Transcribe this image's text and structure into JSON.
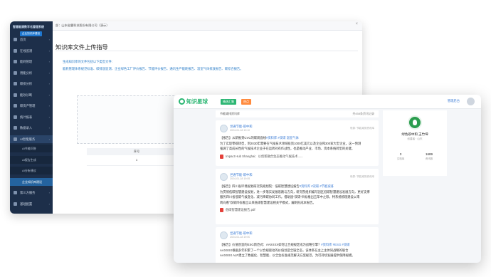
{
  "admin": {
    "brand": "智慧能源数字化管理系统",
    "org": "部：山东省露科技股份有限公司（演示）",
    "tab_label": "企业知识库建设",
    "page_title": "知识库文件上传指导",
    "instructions": "生成知识库的文件包括以下类型文件:",
    "file_types": "能耗管理体系规范标准、碳排放监测、企业绿色工厂评价报告、节能评价报告、通讯生产能耗报告、温室气体排放报告、碳综合报告。",
    "sidebar": [
      {
        "label": "首页"
      },
      {
        "label": "在线监测"
      },
      {
        "label": "能耗管理"
      },
      {
        "label": "用能分析"
      },
      {
        "label": "碳排分析"
      },
      {
        "label": "能效诊断"
      },
      {
        "label": "碳资产管理"
      },
      {
        "label": "统计报表"
      },
      {
        "label": "数据录入"
      },
      {
        "label": "AI智能服务"
      }
    ],
    "sidebar_sub": [
      {
        "label": "AI节能问答"
      },
      {
        "label": "AI报告生成"
      },
      {
        "label": "AI分析建议"
      },
      {
        "label": "企业知识库建设"
      }
    ],
    "sidebar_bottom": [
      {
        "label": "第三方服务"
      },
      {
        "label": "基础配置"
      }
    ],
    "table": {
      "header": "序号",
      "row_value": "1"
    }
  },
  "feed": {
    "logo_text": "知识星球",
    "tab_featured": "精选汇集",
    "tab_hot": "热点",
    "admin_link": "管理后台",
    "filter_label": "节能减排资讯库",
    "result_count": "共458条资讯记录",
    "posts": [
      {
        "author": "世通节能·碳中和",
        "meta": "2024-01-18 19:10",
        "source": "来源: 节能减排资讯库",
        "lines": [
          {
            "text": "【报告】从新推到CVC的碳周面线",
            "tags": "#资料库 #双碳 温室气体"
          },
          {
            "text": "为了实现零碳转型，到2030年需要在气候技术领域投资1000亿美元以及企业和300家大型企业，这一预测",
            "tags": ""
          },
          {
            "text": "强调了高成长性的气候技术企业于在运转对有作战性，也是推动产业、市场、资本系统转型的关键。",
            "tags": ""
          }
        ],
        "attachment": "Impact Hub Shanghai：以创新融合生态推动气候技术......"
      },
      {
        "author": "世通节能·碳中和",
        "meta": "2024-01-18 19:05",
        "source": "来源: 节能减排资讯库",
        "lines": [
          {
            "text": "【报告】四川省环境规划研究院规划院：低碳智慧建设报告",
            "tags": "#资料库 #双碳 #节能减排"
          },
          {
            "text": "为贯彻低碳智慧建设规划，进一步落实发展思路与方向，研究院组织编写园区低碳智慧建设发展方向，更好支撑",
            "tags": ""
          },
          {
            "text": "服务四川省低碳气候变化、减污降碳协同工作。借助国\"双碳\"目标推出五年中之际，特系统梳理建设以来",
            "tags": ""
          },
          {
            "text": "转向看\"双碳目标推出以来低碳智慧建设相关学模式，编制形成本报告。",
            "tags": ""
          }
        ],
        "attachment": "低碳智慧建设报告.pdf"
      },
      {
        "author": "世通节能·碳中和",
        "meta": "2024-01-18 19:00",
        "source": "",
        "lines": [
          {
            "text": "【报告】价值创造的ESG新范式：AAXXXX如何让合规规定成为战略引擎？",
            "tags": "#资料库 #ESG #双碳"
          },
          {
            "text": "AAXXXX根据多年积累了一个以合规驱动的价值创造全链全态，该体系在主上主体同战略的联合",
            "tags": ""
          },
          {
            "text": "AAXXXX ALP建立了数据化、智慧能、以全生标准规范解决方案规范，为可持续发展提供保障规模。",
            "tags": ""
          }
        ],
        "attachment": ""
      }
    ],
    "profile": {
      "name": "绿色碳中和 王竹坤",
      "role": "创建者 · 山东",
      "stats": [
        {
          "num": "3",
          "label": "文档库"
        },
        {
          "num": "1689",
          "label": "资讯数"
        }
      ]
    }
  }
}
